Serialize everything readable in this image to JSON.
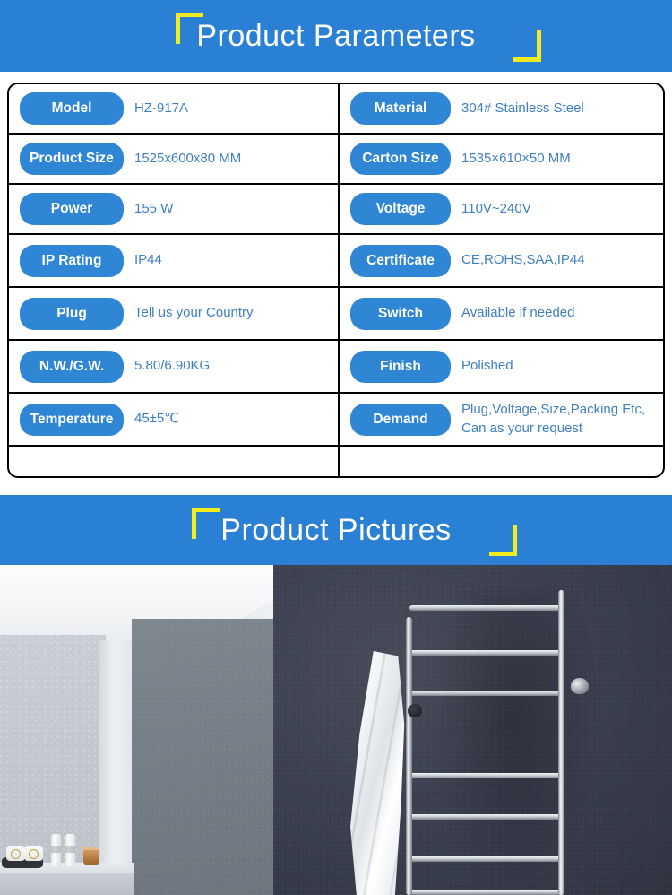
{
  "banners": {
    "parameters": {
      "title": "Product Parameters"
    },
    "pictures": {
      "title": "Product Pictures"
    }
  },
  "colors": {
    "banner_blue": "#2980d4",
    "pill_blue": "#2e86d4",
    "bracket_yellow": "#f2ec1e",
    "value_text": "#3f7fc1",
    "table_border": "#000000"
  },
  "parameters_table": {
    "left_column": [
      {
        "label": "Model",
        "value": [
          "HZ-917A"
        ]
      },
      {
        "label": "Product Size",
        "value": [
          "1525x600x80 MM"
        ]
      },
      {
        "label": "Power",
        "value": [
          "155 W"
        ]
      },
      {
        "label": "IP Rating",
        "value": [
          "IP44"
        ]
      },
      {
        "label": "Plug",
        "value": [
          "Tell us your Country"
        ]
      },
      {
        "label": "N.W./G.W.",
        "value": [
          "5.80/6.90KG"
        ]
      },
      {
        "label": "Temperature",
        "value": [
          "45±5℃"
        ]
      }
    ],
    "right_column": [
      {
        "label": "Material",
        "value": [
          "304# Stainless Steel"
        ]
      },
      {
        "label": "Carton Size",
        "value": [
          "1535×610×50 MM"
        ]
      },
      {
        "label": "Voltage",
        "value": [
          "110V~240V"
        ]
      },
      {
        "label": "Certificate",
        "value": [
          "CE,ROHS,SAA,IP44"
        ]
      },
      {
        "label": "Switch",
        "value": [
          "Available if needed"
        ]
      },
      {
        "label": "Finish",
        "value": [
          "Polished"
        ]
      },
      {
        "label": "Demand",
        "value": [
          "Plug,Voltage,Size,Packing Etc,",
          "Can as your request"
        ]
      }
    ]
  },
  "photos": {
    "left": {
      "alt": "bathroom-interior-photo"
    },
    "right": {
      "alt": "stainless-steel-towel-rack-photo"
    }
  }
}
